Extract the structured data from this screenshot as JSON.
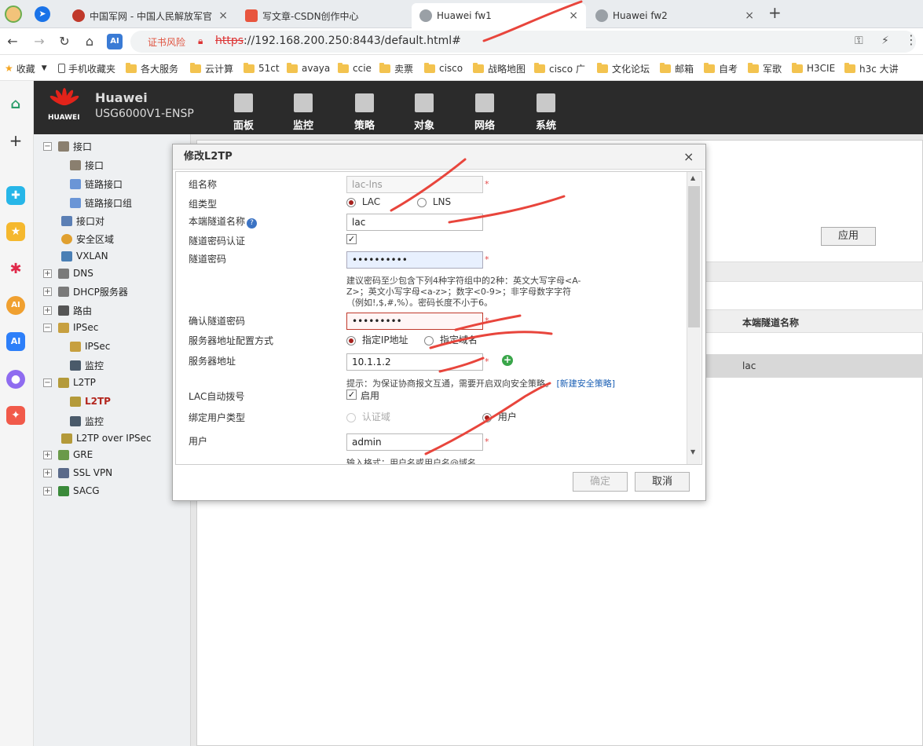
{
  "browser": {
    "tabs": [
      {
        "title": "中国军网 - 中国人民解放军官",
        "color": "#c0392b"
      },
      {
        "title": "写文章-CSDN创作中心",
        "color": "#e8553e"
      },
      {
        "title": "Huawei fw1",
        "color": "#9aa0a6"
      },
      {
        "title": "Huawei fw2",
        "color": "#9aa0a6"
      }
    ],
    "cert_warning": "证书风险",
    "url_scheme": "https",
    "url_rest": "://192.168.200.250:8443/default.html#",
    "bookmarks_label": "收藏",
    "bookmarks": [
      "手机收藏夹",
      "各大服务",
      "云计算",
      "51ct",
      "avaya",
      "ccie",
      "卖票",
      "cisco",
      "战略地图",
      "cisco 广",
      "文化论坛",
      "邮箱",
      "自考",
      "军歌",
      "H3CIE",
      "h3c 大讲"
    ]
  },
  "app": {
    "brand": "Huawei",
    "brand_sub": "HUAWEI",
    "model": "USG6000V1-ENSP",
    "menu": [
      "面板",
      "监控",
      "策略",
      "对象",
      "网络",
      "系统"
    ]
  },
  "tree": [
    {
      "label": "接口",
      "level": 0,
      "exp": "minus"
    },
    {
      "label": "接口",
      "level": 1
    },
    {
      "label": "链路接口",
      "level": 1
    },
    {
      "label": "链路接口组",
      "level": 1
    },
    {
      "label": "接口对",
      "level": 0
    },
    {
      "label": "安全区域",
      "level": 0
    },
    {
      "label": "VXLAN",
      "level": 0
    },
    {
      "label": "DNS",
      "level": 0,
      "exp": "plus"
    },
    {
      "label": "DHCP服务器",
      "level": 0,
      "exp": "plus"
    },
    {
      "label": "路由",
      "level": 0,
      "exp": "plus"
    },
    {
      "label": "IPSec",
      "level": 0,
      "exp": "minus"
    },
    {
      "label": "IPSec",
      "level": 1
    },
    {
      "label": "监控",
      "level": 1
    },
    {
      "label": "L2TP",
      "level": 0,
      "exp": "minus"
    },
    {
      "label": "L2TP",
      "level": 1,
      "selected": true
    },
    {
      "label": "监控",
      "level": 1
    },
    {
      "label": "L2TP over IPSec",
      "level": 0
    },
    {
      "label": "GRE",
      "level": 0,
      "exp": "plus"
    },
    {
      "label": "SSL VPN",
      "level": 0,
      "exp": "plus"
    },
    {
      "label": "SACG",
      "level": 0,
      "exp": "plus"
    }
  ],
  "background_page": {
    "apply_label": "应用",
    "column_header": "本端隧道名称",
    "cell_value": "lac"
  },
  "dialog": {
    "title": "修改L2TP",
    "group_name_label": "组名称",
    "group_name_value": "lac-lns",
    "group_type_label": "组类型",
    "group_type_options": [
      "LAC",
      "LNS"
    ],
    "local_tunnel_label": "本端隧道名称",
    "local_tunnel_value": "lac",
    "tunnel_auth_label": "隧道密码认证",
    "tunnel_pwd_label": "隧道密码",
    "tunnel_pwd_value": "••••••••••",
    "pwd_hint": "建议密码至少包含下列4种字符组中的2种：英文大写字母<A-Z>；英文小写字母<a-z>；数字<0-9>；非字母数字字符（例如!,$,#,%）。密码长度不小于6。",
    "confirm_pwd_label": "确认隧道密码",
    "confirm_pwd_value": "•••••••••",
    "server_mode_label": "服务器地址配置方式",
    "server_mode_options": [
      "指定IP地址",
      "指定域名"
    ],
    "server_addr_label": "服务器地址",
    "server_addr_value": "10.1.1.2",
    "server_tip": "提示：为保证协商报文互通，需要开启双向安全策略。",
    "server_tip_link": "[新建安全策略]",
    "auto_dial_label": "LAC自动拨号",
    "auto_dial_value": "启用",
    "bind_user_type_label": "绑定用户类型",
    "bind_user_type_options": [
      "认证域",
      "用户"
    ],
    "user_label": "用户",
    "user_value": "admin",
    "user_hint": "输入格式：用户名或用户名@域名",
    "ok_label": "确定",
    "cancel_label": "取消",
    "close_glyph": "×"
  }
}
